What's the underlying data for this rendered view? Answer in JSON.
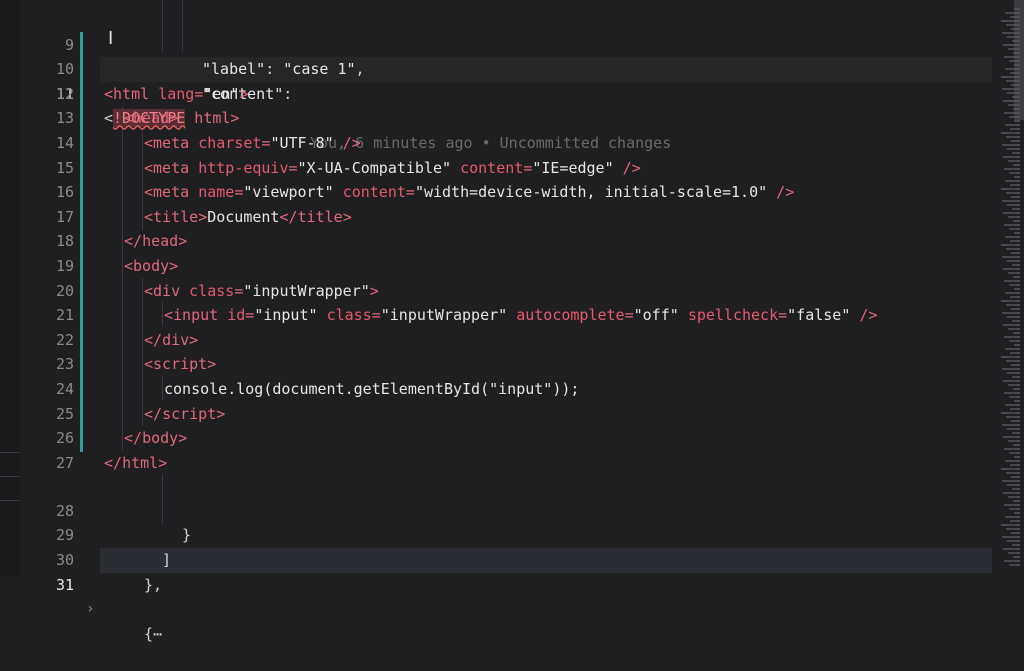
{
  "editor": {
    "lines": [
      {
        "n": "9"
      },
      {
        "n": "10"
      },
      {
        "n": "11"
      },
      {
        "n": "12"
      },
      {
        "n": "13"
      },
      {
        "n": "14"
      },
      {
        "n": "15"
      },
      {
        "n": "16"
      },
      {
        "n": "17"
      },
      {
        "n": "18"
      },
      {
        "n": "19"
      },
      {
        "n": "20"
      },
      {
        "n": "21"
      },
      {
        "n": "22"
      },
      {
        "n": "23"
      },
      {
        "n": "24"
      },
      {
        "n": "25"
      },
      {
        "n": "26"
      },
      {
        "n": "27"
      },
      {
        "n": "28"
      },
      {
        "n": "29"
      },
      {
        "n": "30"
      },
      {
        "n": "31"
      }
    ],
    "blame": "You, 6 minutes ago • Uncommitted changes",
    "code": {
      "l9_key": "\"label\"",
      "l9_sep": ": ",
      "l9_val": "\"case 1\"",
      "l9_end": ",",
      "l10_key": "\"content\"",
      "l10_sep": ":",
      "l11_lt": "<",
      "l11_doctype": "!DOCTYPE",
      "l11_rest": " html>",
      "l12": [
        "<",
        "html",
        " ",
        "lang",
        "=",
        "\"en\"",
        ">"
      ],
      "l13": [
        "<",
        "head",
        ">"
      ],
      "l14": [
        "<",
        "meta",
        " ",
        "charset",
        "=",
        "\"UTF-8\"",
        " />"
      ],
      "l15": [
        "<",
        "meta",
        " ",
        "http-equiv",
        "=",
        "\"X-UA-Compatible\"",
        " ",
        "content",
        "=",
        "\"IE=edge\"",
        " />"
      ],
      "l16": [
        "<",
        "meta",
        " ",
        "name",
        "=",
        "\"viewport\"",
        " ",
        "content",
        "=",
        "\"width=device-width, initial-scale=1.0\"",
        " />"
      ],
      "l17": [
        "<",
        "title",
        ">",
        "Document",
        "</",
        "title",
        ">"
      ],
      "l18": [
        "</",
        "head",
        ">"
      ],
      "l19": [
        "<",
        "body",
        ">"
      ],
      "l20": [
        "<",
        "div",
        " ",
        "class",
        "=",
        "\"inputWrapper\"",
        ">"
      ],
      "l21": [
        "<",
        "input",
        " ",
        "id",
        "=",
        "\"input\"",
        " ",
        "class",
        "=",
        "\"inputWrapper\"",
        " ",
        "autocomplete",
        "=",
        "\"off\"",
        " ",
        "spellcheck",
        "=",
        "\"false\"",
        " />"
      ],
      "l22": [
        "</",
        "div",
        ">"
      ],
      "l23": [
        "<",
        "script",
        ">"
      ],
      "l24": [
        "console",
        ".",
        "log",
        "(",
        "document",
        ".",
        "getElementById",
        "(",
        "\"input\"",
        "));"
      ],
      "l25": [
        "</",
        "script",
        ">"
      ],
      "l26": [
        "</",
        "body",
        ">"
      ],
      "l27": [
        "</",
        "html",
        ">"
      ],
      "l28": "}",
      "l29": "]",
      "l30": "},",
      "l31": "{⋯"
    }
  },
  "icons": {
    "text_cursor": "I-beam-cursor-icon",
    "fold": "chevron-right-icon"
  },
  "colors": {
    "background": "#1f1f22",
    "tag": "#e0697a",
    "attribute": "#e55a6e",
    "string": "#e6e6e6",
    "blame": "#6b6b6b",
    "gutter_accent": "#2f9e9e"
  }
}
